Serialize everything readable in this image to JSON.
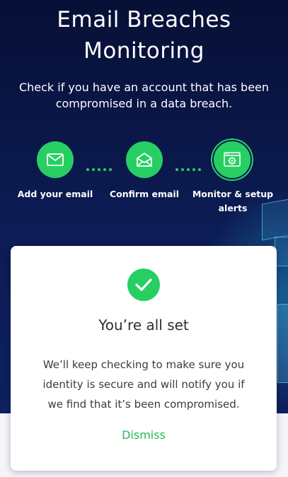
{
  "header": {
    "title_line1": "Email Breaches",
    "title_line2": "Monitoring",
    "subtitle": "Check if you have an account that has been compromised in a data breach."
  },
  "steps": [
    {
      "label": "Add your email",
      "icon": "envelope-icon"
    },
    {
      "label": "Confirm email",
      "icon": "open-envelope-icon"
    },
    {
      "label_line1": "Monitor & setup",
      "label_line2": "alerts",
      "icon": "gear-monitor-icon",
      "active": true
    }
  ],
  "card": {
    "icon": "checkmark-icon",
    "title": "You’re all set",
    "body_line1": "We’ll keep checking to make sure you",
    "body_line2": "identity is secure and will notify you if",
    "body_line3": "we find that it’s been compromised.",
    "dismiss_label": "Dismiss"
  },
  "colors": {
    "accent": "#27cf63",
    "background": "#0c1c55",
    "card": "#ffffff"
  }
}
